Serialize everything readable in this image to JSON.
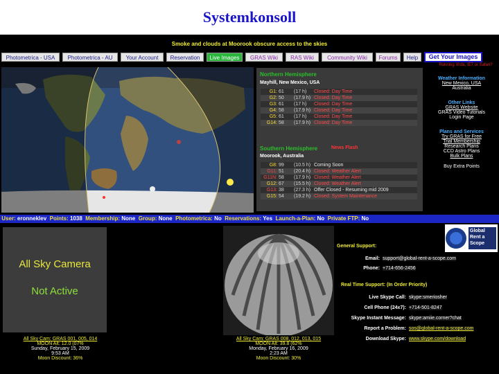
{
  "slide_title": "Systemkonsoll",
  "banner": "Smoke and clouds at Moorook obscure access to the skies",
  "nav": {
    "items": [
      "Photometrica - USA",
      "Photometrica - AU",
      "Your Account",
      "Reservation",
      "Live Images",
      "GRAS Wiki",
      "RAS Wiki",
      "Community Wiki",
      "Forums",
      "Help"
    ],
    "get_images": "Get Your Images",
    "warning": "Running Vista, IE7 or Safari?"
  },
  "northern": {
    "title": "Northern Hemisphere",
    "site": "Mayhill, New Mexico, USA",
    "rows": [
      {
        "name": "G1:",
        "val": "61",
        "hrs": "(17 h)",
        "status": "Closed: Day Time"
      },
      {
        "name": "G2:",
        "val": "50",
        "hrs": "(17.9 h)",
        "status": "Closed: Day Time"
      },
      {
        "name": "G3:",
        "val": "61",
        "hrs": "(17 h)",
        "status": "Closed: Day Time"
      },
      {
        "name": "G4:",
        "val": "58",
        "hrs": "(17.9 h)",
        "status": "Closed: Day Time"
      },
      {
        "name": "G5:",
        "val": "61",
        "hrs": "(17 h)",
        "status": "Closed: Day Time"
      },
      {
        "name": "G14:",
        "val": "58",
        "hrs": "(17.9 h)",
        "status": "Closed: Day Time"
      }
    ]
  },
  "southern": {
    "title": "Southern Hemisphere",
    "flash": "News Flash",
    "site": "Moorook, Australia",
    "rows": [
      {
        "name": "G8:",
        "val": "99",
        "hrs": "(10.5 h)",
        "status": "Coming Soon"
      },
      {
        "name": "G11:",
        "val": "51",
        "hrs": "(20.4 h)",
        "status": "Closed: Weather Alert"
      },
      {
        "name": "G11N:",
        "val": "58",
        "hrs": "(17.9 h)",
        "status": "Closed: Weather Alert"
      },
      {
        "name": "G12:",
        "val": "67",
        "hrs": "(15.5 h)",
        "status": "Closed: Weather Alert"
      },
      {
        "name": "G13:",
        "val": "38",
        "hrs": "(27.3 h)",
        "status": "Offer Closed - Resuming mid 2009"
      },
      {
        "name": "G15:",
        "val": "54",
        "hrs": "(19.2 h)",
        "status": "Closed: System Maintenance"
      }
    ]
  },
  "side_links": {
    "weather_hdr": "Weather Information",
    "weather_1": "New Mexico, USA",
    "weather_2": "Australia",
    "other_hdr": "Other Links",
    "other_1": "GRAS Website",
    "other_2": "GRAS Video Tutorials",
    "other_3": "Login Page",
    "plans_hdr": "Plans and Services",
    "plans_1": "Try GRAS for Free",
    "plans_2": "Trial Membership",
    "plans_3": "Research Plans",
    "plans_4": "CCD Astro Plans",
    "plans_5": "Bulk Plans",
    "plans_6": "Buy Extra Points"
  },
  "userbar": {
    "user_lbl": "User:",
    "user": "eronneklev",
    "points_lbl": "Points:",
    "points": "1038",
    "membership_lbl": "Membership:",
    "membership": "None",
    "group_lbl": "Group:",
    "group": "None",
    "photometrica_lbl": "Photometrica:",
    "photometrica": "No",
    "reservations_lbl": "Reservations:",
    "reservations": "Yes",
    "launch_lbl": "Launch-a-Plan:",
    "launch": "No",
    "ftp_lbl": "Private FTP:",
    "ftp": "No"
  },
  "allsky": {
    "line1": "All Sky Camera",
    "line2": "Not Active"
  },
  "cam1": {
    "link": "All Sky Cam: GRAS 001, 005, 014",
    "moon": "MOON Alt: 12.0 (07%",
    "date": "Sunday, February 15, 2009",
    "time": "9:53 AM",
    "discount": "Moon Discount: 36%"
  },
  "cam2": {
    "link": "All Sky Cam: GRAS 008, 012, 013, 015",
    "moon": "MOON Alt: 39.8 (62%",
    "date": "Monday, February 16, 2009",
    "time": "2:23 AM",
    "discount": "Moon Discount: 30%"
  },
  "logo": {
    "l1": "Global",
    "l2": "Rent a",
    "l3": "Scope"
  },
  "support": {
    "general": "General Support:",
    "email_k": "Email:",
    "email_v": "support@global-rent-a-scope.com",
    "phone_k": "Phone:",
    "phone_v": "+714-656-2456",
    "realtime": "Real Time Support: (In Order Priority)",
    "skype_k": "Live Skype Call:",
    "skype_v": "skype:smeriosher",
    "cell_k": "Cell Phone (24x7):",
    "cell_v": "+714-501-8247",
    "im_k": "Skype Instant Message:",
    "im_v": "skype:amiie.corner?chat",
    "report_k": "Report a Problem:",
    "report_v": "sos@global-rent-a-scope.com",
    "download_k": "Download Skype:",
    "download_v": "www.skype.com/download"
  }
}
